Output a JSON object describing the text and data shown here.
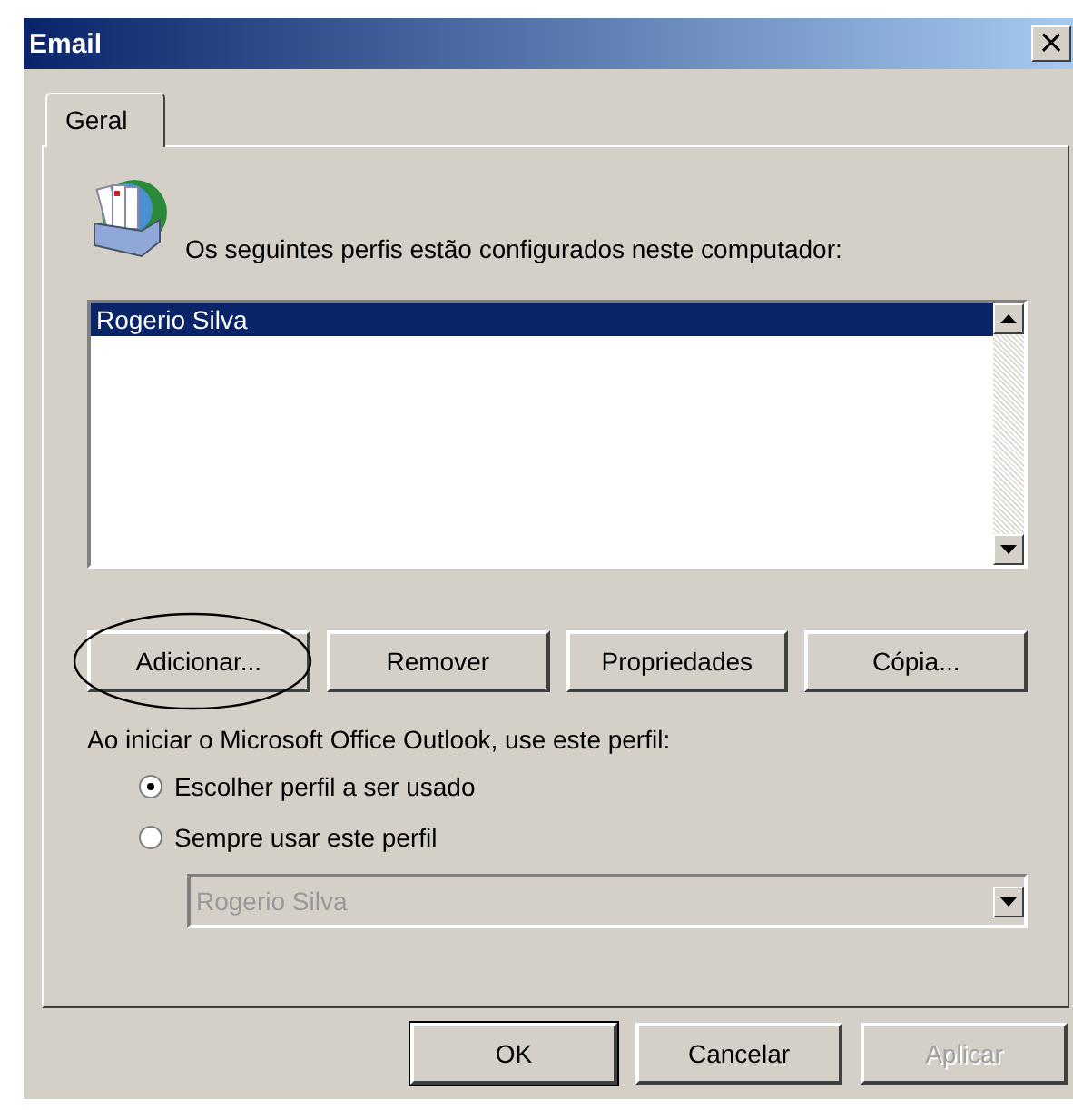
{
  "window": {
    "title": "Email",
    "close": "×"
  },
  "tabs": [
    {
      "label": "Geral",
      "selected": true
    }
  ],
  "profiles_label": "Os seguintes perfis estão configurados neste computador:",
  "profiles": [
    {
      "name": "Rogerio Silva",
      "selected": true
    }
  ],
  "profile_buttons": [
    {
      "label": "Adicionar...",
      "disabled": false,
      "circled": true
    },
    {
      "label": "Remover",
      "disabled": false,
      "circled": false
    },
    {
      "label": "Propriedades",
      "disabled": false,
      "circled": false
    },
    {
      "label": "Cópia...",
      "disabled": false,
      "circled": false
    }
  ],
  "startup_label": "Ao iniciar o Microsoft Office Outlook, use este perfil:",
  "startup_options": [
    {
      "label": "Escolher perfil a ser usado",
      "selected": true
    },
    {
      "label": "Sempre usar este perfil",
      "selected": false
    }
  ],
  "profile_dropdown": {
    "value": "Rogerio Silva",
    "disabled": true
  },
  "footer_buttons": [
    {
      "label": "OK",
      "disabled": false,
      "default": true
    },
    {
      "label": "Cancelar",
      "disabled": false,
      "default": false
    },
    {
      "label": "Aplicar",
      "disabled": true,
      "default": false
    }
  ]
}
